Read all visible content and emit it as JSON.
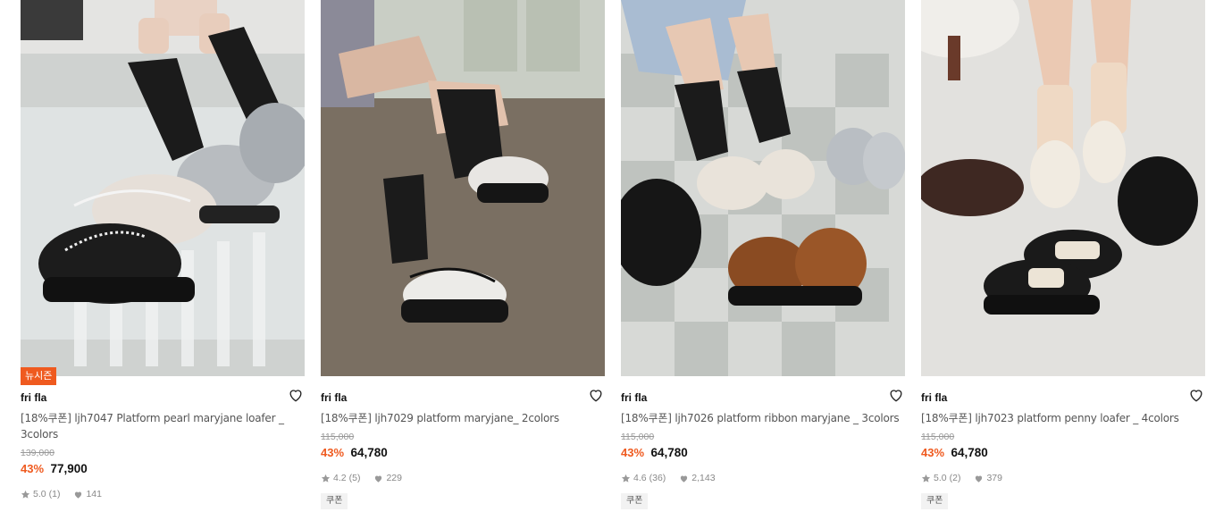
{
  "products": [
    {
      "badge": "뉴시즌",
      "brand": "fri fla",
      "title": "[18%쿠폰] ljh7047 Platform pearl maryjane loafer _ 3colors",
      "original_price": "139,000",
      "discount": "43%",
      "sale_price": "77,900",
      "rating": "5.0",
      "review_count": "(1)",
      "likes": "141",
      "coupon": "",
      "image_icon": "product-photo"
    },
    {
      "badge": "",
      "brand": "fri fla",
      "title": "[18%쿠폰] ljh7029 platform maryjane_ 2colors",
      "original_price": "115,000",
      "discount": "43%",
      "sale_price": "64,780",
      "rating": "4.2",
      "review_count": "(5)",
      "likes": "229",
      "coupon": "쿠폰",
      "image_icon": "product-photo"
    },
    {
      "badge": "",
      "brand": "fri fla",
      "title": "[18%쿠폰] ljh7026 platform ribbon maryjane _ 3colors",
      "original_price": "115,000",
      "discount": "43%",
      "sale_price": "64,780",
      "rating": "4.6",
      "review_count": "(36)",
      "likes": "2,143",
      "coupon": "쿠폰",
      "image_icon": "product-photo"
    },
    {
      "badge": "",
      "brand": "fri fla",
      "title": "[18%쿠폰] ljh7023 platform penny loafer _ 4colors",
      "original_price": "115,000",
      "discount": "43%",
      "sale_price": "64,780",
      "rating": "5.0",
      "review_count": "(2)",
      "likes": "379",
      "coupon": "쿠폰",
      "image_icon": "product-photo"
    }
  ],
  "colors": {
    "accent": "#ef5a1f",
    "text": "#111111",
    "muted": "#999999"
  }
}
